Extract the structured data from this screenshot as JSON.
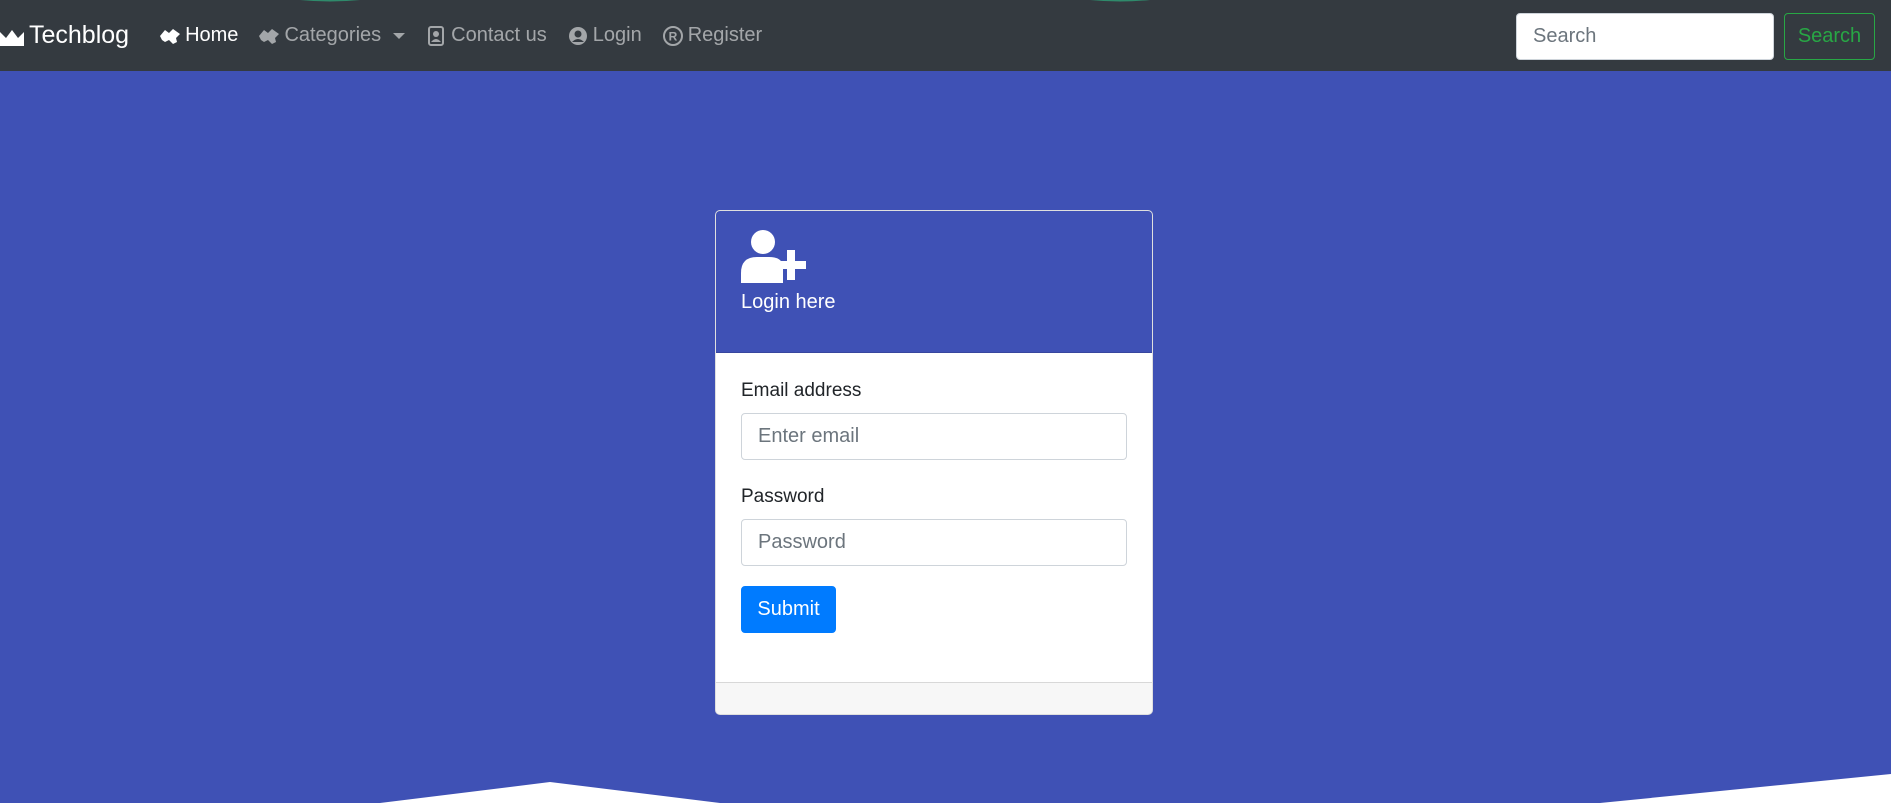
{
  "navbar": {
    "brand": "Techblog",
    "brand_icon": "crown-icon",
    "items": [
      {
        "label": "Home",
        "icon": "hands-icon",
        "active": true
      },
      {
        "label": "Categories",
        "icon": "hands-icon",
        "dropdown": true
      },
      {
        "label": "Contact us",
        "icon": "contact-card-icon"
      },
      {
        "label": "Login",
        "icon": "user-circle-icon"
      },
      {
        "label": "Register",
        "icon": "registered-icon"
      }
    ],
    "search": {
      "placeholder": "Search",
      "button_label": "Search"
    }
  },
  "card": {
    "header_icon": "user-plus-icon",
    "title": "Login here",
    "email_label": "Email address",
    "email_placeholder": "Enter email",
    "password_label": "Password",
    "password_placeholder": "Password",
    "submit_label": "Submit"
  },
  "colors": {
    "navbar_bg": "#343a40",
    "page_bg": "#3f51b5",
    "primary": "#007bff",
    "success": "#28a745"
  }
}
